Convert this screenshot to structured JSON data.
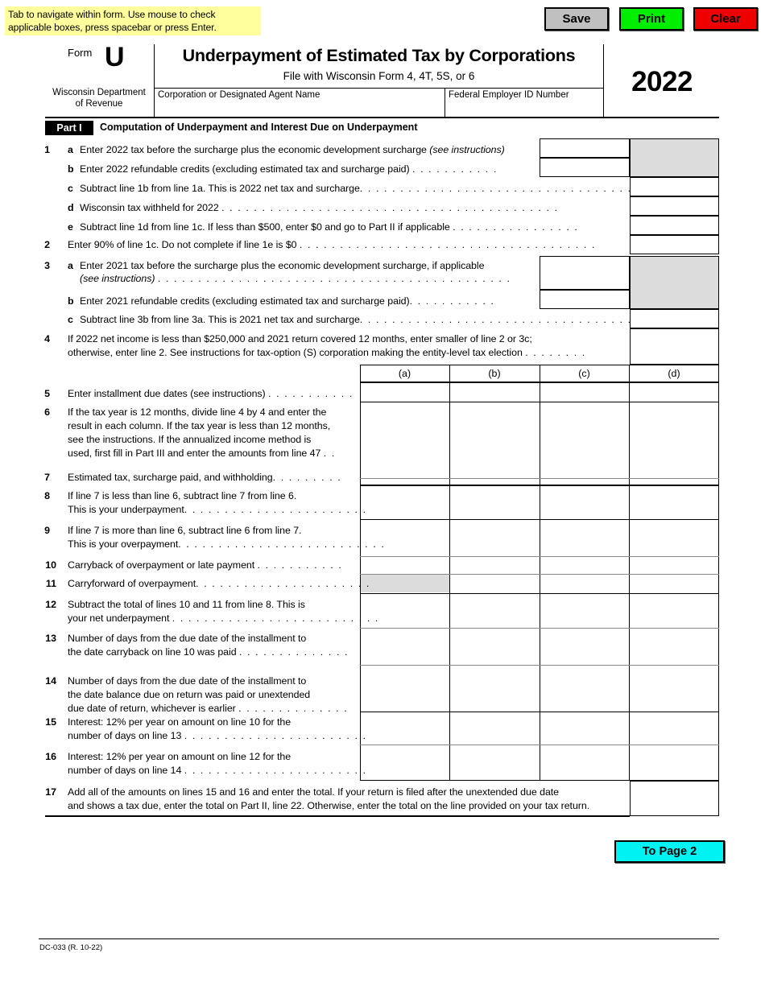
{
  "instructions": {
    "text": "Tab to navigate within form. Use mouse to check applicable boxes, press spacebar or press Enter."
  },
  "toolbar": {
    "save_label": "Save",
    "print_label": "Print",
    "clear_label": "Clear",
    "save_color": "#c0c0c0",
    "print_color": "#00ee00",
    "clear_color": "#ee0000"
  },
  "header": {
    "form_word": "Form",
    "form_letter": "U",
    "department_line1": "Wisconsin Department",
    "department_line2": "of Revenue",
    "title": "Underpayment of Estimated Tax by Corporations",
    "subtitle": "File with Wisconsin Form 4, 4T, 5S, or 6",
    "corp_name_label": "Corporation or Designated Agent Name",
    "fein_label": "Federal Employer ID Number",
    "year": "2022"
  },
  "part1": {
    "tag": "Part I",
    "title": "Computation of Underpayment and Interest Due on Underpayment"
  },
  "columns": {
    "a": "(a)",
    "b": "(b)",
    "c": "(c)",
    "d": "(d)"
  },
  "lines": {
    "l1": "1",
    "l1a_sub": "a",
    "l1a": "Enter 2022 tax before the surcharge plus the economic development surcharge ",
    "l1a_italic": "(see instructions)",
    "l1b_sub": "b",
    "l1b": "Enter 2022 refundable credits (excluding estimated tax and surcharge paid)",
    "l1b_dots": ". . . . . . . . . . .",
    "l1c_sub": "c",
    "l1c": "Subtract line 1b from line 1a. This is 2022 net tax and surcharge",
    "l1c_dots": ". . . . . . . . . . . . . . . . . . . . . . . . . . . . . . . . . .",
    "l1d_sub": "d",
    "l1d": "Wisconsin tax withheld for 2022 ",
    "l1d_dots": ". . . . . . . . . . . . . . . . . . . . . . . . . . . . . . . . . . . . . . . . . .",
    "l1e_sub": "e",
    "l1e": "Subtract line 1d from line 1c. If less than $500, enter $0 and go to Part II if applicable ",
    "l1e_dots": ". . . . . . . . . . . . . . . .",
    "l2": "2",
    "l2_text": "Enter 90% of line 1c. Do not complete if line 1e is $0 ",
    "l2_dots": ". . . . . . . . . . . . . . . . . . . . . . . . . . . . . . . . . . . . .",
    "l3": "3",
    "l3a_sub": "a",
    "l3a_line1": "Enter 2021 tax before the surcharge plus the economic development surcharge, if applicable",
    "l3a_line2": "(see instructions)",
    "l3a_dots": ". . . . . . . . . . . . . . . . . . . . . . . . . . . . . . . . . . . . . . . . . . . .",
    "l3b_sub": "b",
    "l3b": "Enter 2021 refundable credits (excluding estimated tax and surcharge paid)",
    "l3b_dots": ". . . . . . . . . . .",
    "l3c_sub": "c",
    "l3c": "Subtract line 3b from line 3a. This is 2021 net tax and surcharge",
    "l3c_dots": ". . . . . . . . . . . . . . . . . . . . . . . . . . . . . . . . . .",
    "l4": "4",
    "l4_line1": "If 2022 net income is less than $250,000 and 2021 return covered 12 months, enter smaller of line 2 or 3c;",
    "l4_line2": "otherwise, enter line 2. See instructions for tax-option (S) corporation making the entity-level tax election ",
    "l4_dots": ". . . . . . . .",
    "l5": "5",
    "l5_text": "Enter installment due dates (see instructions) ",
    "l5_dots": ". . . . . . . . . . .",
    "l6": "6",
    "l6_line1": "If the tax year is 12 months, divide line 4 by 4 and enter the",
    "l6_line2": "result in each column. If the tax year is less than 12 months,",
    "l6_line3": "see the instructions. If the annualized income method is",
    "l6_line4": "used, first fill in Part III and enter the amounts from line 47 ",
    "l6_dots": ". .",
    "l7": "7",
    "l7_text": "Estimated tax, surcharge paid, and withholding",
    "l7_dots": ". . . . . . . . .",
    "l8": "8",
    "l8_line1": "If line 7 is less than line 6, subtract line 7 from line 6.",
    "l8_line2": "This is your underpayment",
    "l8_dots": ". . . . . . . . . . . . . . . . . . . . . . .",
    "l9": "9",
    "l9_line1": "If line 7 is more than line 6, subtract line 6 from line 7.",
    "l9_line2": "This is your overpayment",
    "l9_dots": ". . . . . . . . . . . . . . . . . . . . . . . . . .",
    "l10": "10",
    "l10_text": "Carryback of overpayment or late payment ",
    "l10_dots": ". . . . . . . . . . .",
    "l11": "11",
    "l11_text": "Carryforward of overpayment",
    "l11_dots": ". . . . . . . . . . . . . . . . . . . . . .",
    "l12": "12",
    "l12_line1": "Subtract the total of lines 10 and 11 from line 8. This is",
    "l12_line2": "your net underpayment ",
    "l12_dots": ". . . . . . . . . . . . . . . . . . . . . . . . . .",
    "l13": "13",
    "l13_line1": "Number of days from the due date of the installment to",
    "l13_line2": "the date carryback on line 10 was paid ",
    "l13_dots": ". . . . . . . . . . . . . .",
    "l14": "14",
    "l14_line1": "Number of days from the due date of the installment to",
    "l14_line2": "the date balance due on return was paid or unextended",
    "l14_line3": "due date of return, whichever is earlier ",
    "l14_dots": ". . . . . . . . . . . . . .",
    "l15": "15",
    "l15_line1": "Interest: 12% per year on amount on line 10 for the",
    "l15_line2": "number of days on line 13 ",
    "l15_dots": ". . . . . . . . . . . . . . . . . . . . . . .",
    "l16": "16",
    "l16_line1": "Interest: 12% per year on amount on line 12 for the",
    "l16_line2": "number of days on line 14 ",
    "l16_dots": ". . . . . . . . . . . . . . . . . . . . . . .",
    "l17": "17",
    "l17_line1": "Add all of the amounts on lines 15 and 16 and enter the total. If your return is filed after the unextended due date",
    "l17_line2": "and shows a tax due, enter the total on Part II, line 22. Otherwise, enter the total on the line provided on your tax return."
  },
  "footer": {
    "to_page_2_label": "To Page 2",
    "form_code": "DC-033 (R. 10-22)"
  }
}
